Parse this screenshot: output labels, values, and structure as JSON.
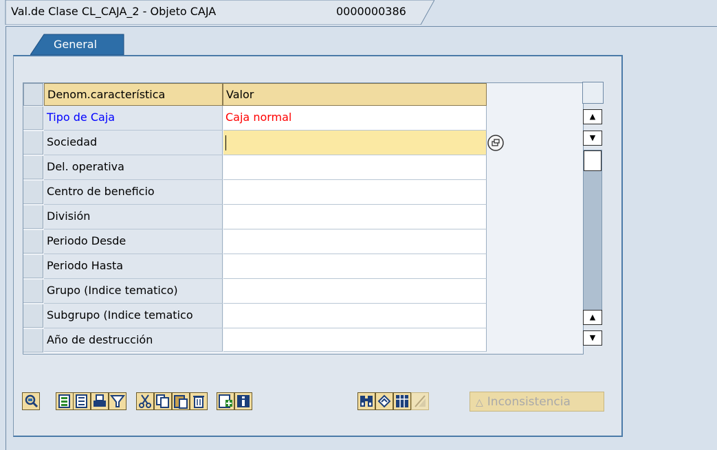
{
  "header": {
    "title": "Val.de Clase CL_CAJA_2 - Objeto CAJA",
    "object_id": "0000000386"
  },
  "tabs": [
    {
      "label": "General",
      "active": true
    }
  ],
  "table": {
    "columns": [
      "Denom.característica",
      "Valor"
    ],
    "rows": [
      {
        "name": "Tipo de Caja",
        "value": "Caja normal",
        "name_color": "#0000ff",
        "value_color": "#ff0000"
      },
      {
        "name": "Sociedad",
        "value": ""
      },
      {
        "name": "Del. operativa",
        "value": ""
      },
      {
        "name": "Centro de beneficio",
        "value": ""
      },
      {
        "name": "División",
        "value": ""
      },
      {
        "name": "Periodo Desde",
        "value": ""
      },
      {
        "name": "Periodo Hasta",
        "value": ""
      },
      {
        "name": "Grupo (Indice tematico)",
        "value": ""
      },
      {
        "name": "Subgrupo (Indice tematico",
        "value": ""
      },
      {
        "name": "Año de destrucción",
        "value": ""
      }
    ],
    "focused_row": 2
  },
  "toolbar": {
    "buttons": [
      "details-icon",
      "select-all-icon",
      "deselect-all-icon",
      "print-icon",
      "filter-icon",
      "cut-icon",
      "copy-icon",
      "paste-icon",
      "delete-icon",
      "insert-row-icon",
      "information-icon",
      "find-icon",
      "undo-icon",
      "layout-icon",
      "sum-icon"
    ],
    "inconsistency_label": "Inconsistencia"
  },
  "colors": {
    "background": "#d7e1ec",
    "header_bg": "#f1dca0",
    "tab_bg": "#2d6ea8",
    "focus_bg": "#fbe9a3",
    "link_blue": "#0000ff",
    "value_red": "#ff0000"
  }
}
